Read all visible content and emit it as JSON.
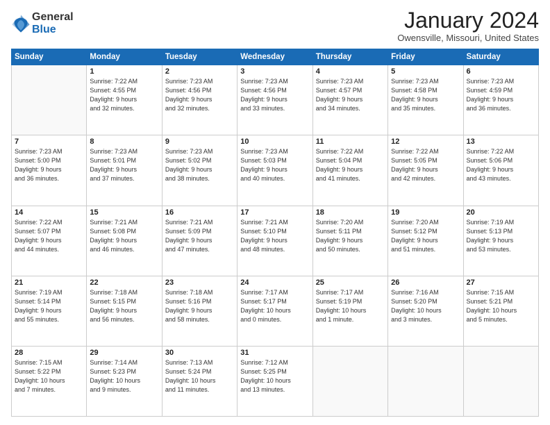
{
  "logo": {
    "general": "General",
    "blue": "Blue"
  },
  "title": {
    "month_year": "January 2024",
    "location": "Owensville, Missouri, United States"
  },
  "weekdays": [
    "Sunday",
    "Monday",
    "Tuesday",
    "Wednesday",
    "Thursday",
    "Friday",
    "Saturday"
  ],
  "weeks": [
    [
      {
        "day": "",
        "info": ""
      },
      {
        "day": "1",
        "info": "Sunrise: 7:22 AM\nSunset: 4:55 PM\nDaylight: 9 hours\nand 32 minutes."
      },
      {
        "day": "2",
        "info": "Sunrise: 7:23 AM\nSunset: 4:56 PM\nDaylight: 9 hours\nand 32 minutes."
      },
      {
        "day": "3",
        "info": "Sunrise: 7:23 AM\nSunset: 4:56 PM\nDaylight: 9 hours\nand 33 minutes."
      },
      {
        "day": "4",
        "info": "Sunrise: 7:23 AM\nSunset: 4:57 PM\nDaylight: 9 hours\nand 34 minutes."
      },
      {
        "day": "5",
        "info": "Sunrise: 7:23 AM\nSunset: 4:58 PM\nDaylight: 9 hours\nand 35 minutes."
      },
      {
        "day": "6",
        "info": "Sunrise: 7:23 AM\nSunset: 4:59 PM\nDaylight: 9 hours\nand 36 minutes."
      }
    ],
    [
      {
        "day": "7",
        "info": "Sunrise: 7:23 AM\nSunset: 5:00 PM\nDaylight: 9 hours\nand 36 minutes."
      },
      {
        "day": "8",
        "info": "Sunrise: 7:23 AM\nSunset: 5:01 PM\nDaylight: 9 hours\nand 37 minutes."
      },
      {
        "day": "9",
        "info": "Sunrise: 7:23 AM\nSunset: 5:02 PM\nDaylight: 9 hours\nand 38 minutes."
      },
      {
        "day": "10",
        "info": "Sunrise: 7:23 AM\nSunset: 5:03 PM\nDaylight: 9 hours\nand 40 minutes."
      },
      {
        "day": "11",
        "info": "Sunrise: 7:22 AM\nSunset: 5:04 PM\nDaylight: 9 hours\nand 41 minutes."
      },
      {
        "day": "12",
        "info": "Sunrise: 7:22 AM\nSunset: 5:05 PM\nDaylight: 9 hours\nand 42 minutes."
      },
      {
        "day": "13",
        "info": "Sunrise: 7:22 AM\nSunset: 5:06 PM\nDaylight: 9 hours\nand 43 minutes."
      }
    ],
    [
      {
        "day": "14",
        "info": "Sunrise: 7:22 AM\nSunset: 5:07 PM\nDaylight: 9 hours\nand 44 minutes."
      },
      {
        "day": "15",
        "info": "Sunrise: 7:21 AM\nSunset: 5:08 PM\nDaylight: 9 hours\nand 46 minutes."
      },
      {
        "day": "16",
        "info": "Sunrise: 7:21 AM\nSunset: 5:09 PM\nDaylight: 9 hours\nand 47 minutes."
      },
      {
        "day": "17",
        "info": "Sunrise: 7:21 AM\nSunset: 5:10 PM\nDaylight: 9 hours\nand 48 minutes."
      },
      {
        "day": "18",
        "info": "Sunrise: 7:20 AM\nSunset: 5:11 PM\nDaylight: 9 hours\nand 50 minutes."
      },
      {
        "day": "19",
        "info": "Sunrise: 7:20 AM\nSunset: 5:12 PM\nDaylight: 9 hours\nand 51 minutes."
      },
      {
        "day": "20",
        "info": "Sunrise: 7:19 AM\nSunset: 5:13 PM\nDaylight: 9 hours\nand 53 minutes."
      }
    ],
    [
      {
        "day": "21",
        "info": "Sunrise: 7:19 AM\nSunset: 5:14 PM\nDaylight: 9 hours\nand 55 minutes."
      },
      {
        "day": "22",
        "info": "Sunrise: 7:18 AM\nSunset: 5:15 PM\nDaylight: 9 hours\nand 56 minutes."
      },
      {
        "day": "23",
        "info": "Sunrise: 7:18 AM\nSunset: 5:16 PM\nDaylight: 9 hours\nand 58 minutes."
      },
      {
        "day": "24",
        "info": "Sunrise: 7:17 AM\nSunset: 5:17 PM\nDaylight: 10 hours\nand 0 minutes."
      },
      {
        "day": "25",
        "info": "Sunrise: 7:17 AM\nSunset: 5:19 PM\nDaylight: 10 hours\nand 1 minute."
      },
      {
        "day": "26",
        "info": "Sunrise: 7:16 AM\nSunset: 5:20 PM\nDaylight: 10 hours\nand 3 minutes."
      },
      {
        "day": "27",
        "info": "Sunrise: 7:15 AM\nSunset: 5:21 PM\nDaylight: 10 hours\nand 5 minutes."
      }
    ],
    [
      {
        "day": "28",
        "info": "Sunrise: 7:15 AM\nSunset: 5:22 PM\nDaylight: 10 hours\nand 7 minutes."
      },
      {
        "day": "29",
        "info": "Sunrise: 7:14 AM\nSunset: 5:23 PM\nDaylight: 10 hours\nand 9 minutes."
      },
      {
        "day": "30",
        "info": "Sunrise: 7:13 AM\nSunset: 5:24 PM\nDaylight: 10 hours\nand 11 minutes."
      },
      {
        "day": "31",
        "info": "Sunrise: 7:12 AM\nSunset: 5:25 PM\nDaylight: 10 hours\nand 13 minutes."
      },
      {
        "day": "",
        "info": ""
      },
      {
        "day": "",
        "info": ""
      },
      {
        "day": "",
        "info": ""
      }
    ]
  ]
}
